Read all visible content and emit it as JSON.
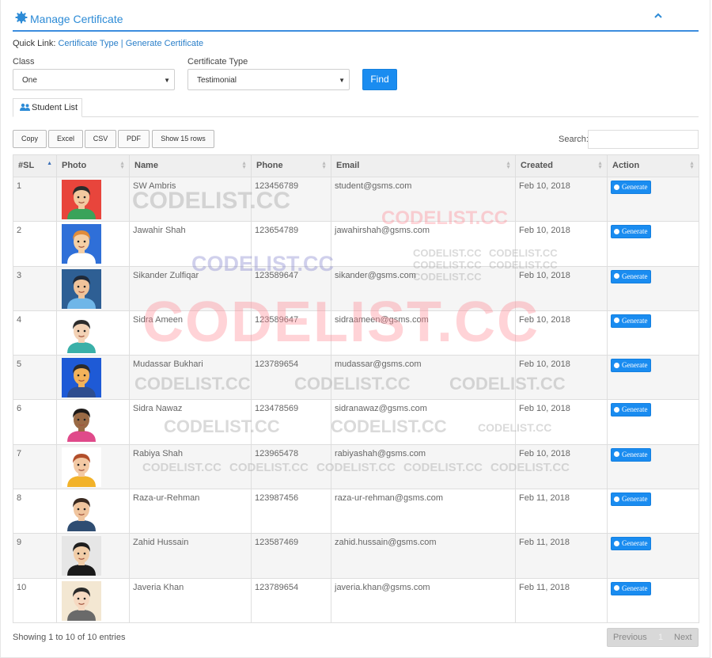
{
  "header": {
    "title": "Manage Certificate",
    "icon": "gear-icon",
    "collapse_icon": "chevron-up-icon",
    "accent": "#3c8dde"
  },
  "quick_links": {
    "prefix": "Quick Link:",
    "links": [
      "Certificate Type",
      "Generate Certificate"
    ],
    "separator": "|"
  },
  "filters": {
    "class_label": "Class",
    "class_value": "One",
    "type_label": "Certificate Type",
    "type_value": "Testimonial",
    "find_label": "Find"
  },
  "tab": {
    "label": "Student List",
    "icon": "users-icon"
  },
  "toolbar": {
    "buttons": [
      "Copy",
      "Excel",
      "CSV",
      "PDF",
      "Show 15 rows"
    ],
    "search_label": "Search:"
  },
  "table": {
    "columns": [
      "#SL",
      "Photo",
      "Name",
      "Phone",
      "Email",
      "Created",
      "Action"
    ],
    "action_label": "Generate",
    "rows": [
      {
        "sl": "1",
        "name": "SW Ambris",
        "phone": "123456789",
        "email": "student@gsms.com",
        "created": "Feb 10, 2018"
      },
      {
        "sl": "2",
        "name": "Jawahir Shah",
        "phone": "123654789",
        "email": "jawahirshah@gsms.com",
        "created": "Feb 10, 2018"
      },
      {
        "sl": "3",
        "name": "Sikander Zulfiqar",
        "phone": "123589647",
        "email": "sikander@gsms.com",
        "created": "Feb 10, 2018"
      },
      {
        "sl": "4",
        "name": "Sidra Ameen",
        "phone": "123589647",
        "email": "sidraameen@gsms.com",
        "created": "Feb 10, 2018"
      },
      {
        "sl": "5",
        "name": "Mudassar Bukhari",
        "phone": "123789654",
        "email": "mudassar@gsms.com",
        "created": "Feb 10, 2018"
      },
      {
        "sl": "6",
        "name": "Sidra Nawaz",
        "phone": "123478569",
        "email": "sidranawaz@gsms.com",
        "created": "Feb 10, 2018"
      },
      {
        "sl": "7",
        "name": "Rabiya Shah",
        "phone": "123965478",
        "email": "rabiyashah@gsms.com",
        "created": "Feb 10, 2018"
      },
      {
        "sl": "8",
        "name": "Raza-ur-Rehman",
        "phone": "123987456",
        "email": "raza-ur-rehman@gsms.com",
        "created": "Feb 11, 2018"
      },
      {
        "sl": "9",
        "name": "Zahid Hussain",
        "phone": "123587469",
        "email": "zahid.hussain@gsms.com",
        "created": "Feb 11, 2018"
      },
      {
        "sl": "10",
        "name": "Javeria Khan",
        "phone": "123789654",
        "email": "javeria.khan@gsms.com",
        "created": "Feb 11, 2018"
      }
    ]
  },
  "footer": {
    "info": "Showing 1 to 10 of 10 entries",
    "prev": "Previous",
    "page": "1",
    "next": "Next"
  },
  "watermark": "CODELIST.CC",
  "colors": {
    "primary_button": "#1a8cf0",
    "link": "#2a7fc9"
  }
}
